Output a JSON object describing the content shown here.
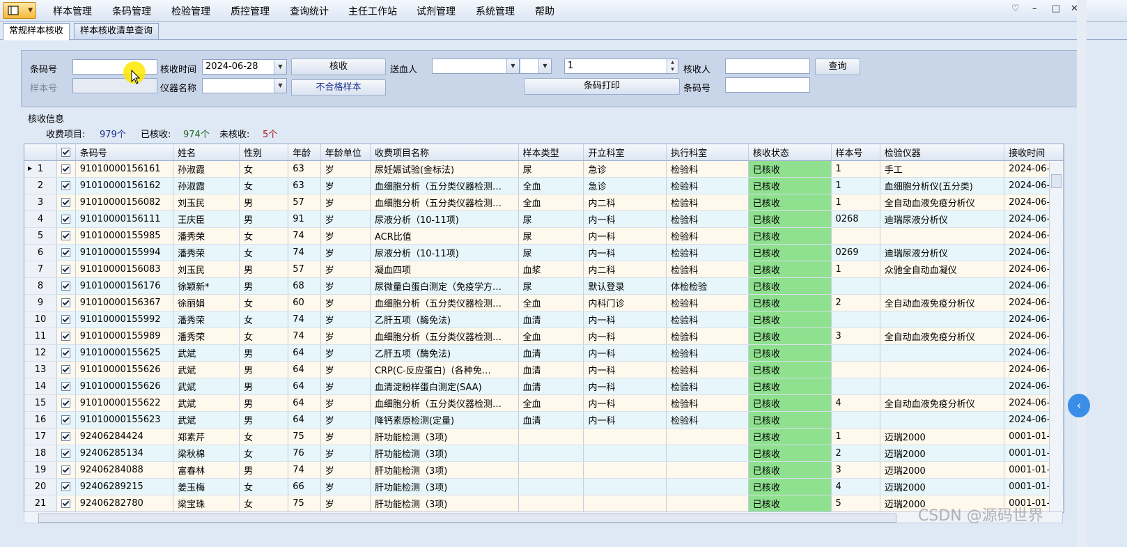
{
  "menu": {
    "items": [
      "样本管理",
      "条码管理",
      "检验管理",
      "质控管理",
      "查询统计",
      "主任工作站",
      "试剂管理",
      "系统管理",
      "帮助"
    ],
    "window_controls": [
      "♡",
      "–",
      "□",
      "✕"
    ]
  },
  "tabs": [
    "常规样本核收",
    "样本核收清单查询"
  ],
  "query": {
    "barcode_label": "条码号",
    "sample_no_label": "样本号",
    "receive_time_label": "核收时间",
    "receive_time_value": "2024-06-28",
    "instrument_label": "仪器名称",
    "instrument_value": "",
    "receive_button": "核收",
    "unqualified_button": "不合格样本",
    "sender_label": "送血人",
    "sender_value": "",
    "sender_sub_value": "",
    "spin_value": "1",
    "print_button": "条码打印",
    "receiver_label": "核收人",
    "receiver_value": "",
    "query_button": "查询",
    "barcode2_label": "条码号",
    "barcode2_value": ""
  },
  "info": {
    "title": "核收信息",
    "fee_items_label": "收费项目:",
    "fee_items_value": "979个",
    "received_label": "已核收:",
    "received_value": "974个",
    "unreceived_label": "未核收:",
    "unreceived_value": "5个"
  },
  "colors": {
    "fee_items": "#1a2d8f",
    "received": "#1f6b1f",
    "unreceived": "#b01515",
    "status_cell": "#8fe08f"
  },
  "grid": {
    "columns": [
      "",
      "",
      "条码号",
      "姓名",
      "性别",
      "年龄",
      "年龄单位",
      "收费项目名称",
      "样本类型",
      "开立科室",
      "执行科室",
      "核收状态",
      "样本号",
      "检验仪器",
      "接收时间"
    ],
    "rows": [
      [
        "1",
        "91010000156161",
        "孙淑霞",
        "女",
        "63",
        "岁",
        "尿妊娠试验(金标法)",
        "尿",
        "急诊",
        "检验科",
        "已核收",
        "1",
        "手工",
        "2024-06-"
      ],
      [
        "2",
        "91010000156162",
        "孙淑霞",
        "女",
        "63",
        "岁",
        "血细胞分析（五分类仪器检测…",
        "全血",
        "急诊",
        "检验科",
        "已核收",
        "1",
        "血细胞分析仪(五分类)",
        "2024-06-"
      ],
      [
        "3",
        "91010000156082",
        "刘玉民",
        "男",
        "57",
        "岁",
        "血细胞分析（五分类仪器检测…",
        "全血",
        "内二科",
        "检验科",
        "已核收",
        "1",
        "全自动血液免疫分析仪",
        "2024-06-"
      ],
      [
        "4",
        "91010000156111",
        "王庆臣",
        "男",
        "91",
        "岁",
        "尿液分析（10-11项)",
        "尿",
        "内一科",
        "检验科",
        "已核收",
        "0268",
        "迪瑞尿液分析仪",
        "2024-06-"
      ],
      [
        "5",
        "91010000155985",
        "潘秀荣",
        "女",
        "74",
        "岁",
        "ACR比值",
        "尿",
        "内一科",
        "检验科",
        "已核收",
        "",
        "",
        "2024-06-"
      ],
      [
        "6",
        "91010000155994",
        "潘秀荣",
        "女",
        "74",
        "岁",
        "尿液分析（10-11项)",
        "尿",
        "内一科",
        "检验科",
        "已核收",
        "0269",
        "迪瑞尿液分析仪",
        "2024-06-"
      ],
      [
        "7",
        "91010000156083",
        "刘玉民",
        "男",
        "57",
        "岁",
        "凝血四项",
        "血浆",
        "内二科",
        "检验科",
        "已核收",
        "1",
        "众驰全自动血凝仪",
        "2024-06-"
      ],
      [
        "8",
        "91010000156176",
        "徐颖新*",
        "男",
        "68",
        "岁",
        "尿微量白蛋白测定（免疫学方…",
        "尿",
        "默认登录",
        "体检检验",
        "已核收",
        "",
        "",
        "2024-06-"
      ],
      [
        "9",
        "91010000156367",
        "徐丽娟",
        "女",
        "60",
        "岁",
        "血细胞分析（五分类仪器检测…",
        "全血",
        "内科门诊",
        "检验科",
        "已核收",
        "2",
        "全自动血液免疫分析仪",
        "2024-06-"
      ],
      [
        "10",
        "91010000155992",
        "潘秀荣",
        "女",
        "74",
        "岁",
        "乙肝五项（酶免法)",
        "血清",
        "内一科",
        "检验科",
        "已核收",
        "",
        "",
        "2024-06-"
      ],
      [
        "11",
        "91010000155989",
        "潘秀荣",
        "女",
        "74",
        "岁",
        "血细胞分析（五分类仪器检测…",
        "全血",
        "内一科",
        "检验科",
        "已核收",
        "3",
        "全自动血液免疫分析仪",
        "2024-06-"
      ],
      [
        "12",
        "91010000155625",
        "武斌",
        "男",
        "64",
        "岁",
        "乙肝五项（酶免法)",
        "血清",
        "内一科",
        "检验科",
        "已核收",
        "",
        "",
        "2024-06-"
      ],
      [
        "13",
        "91010000155626",
        "武斌",
        "男",
        "64",
        "岁",
        "CRP(C-反应蛋白)（各种免…",
        "血清",
        "内一科",
        "检验科",
        "已核收",
        "",
        "",
        "2024-06-"
      ],
      [
        "14",
        "91010000155626",
        "武斌",
        "男",
        "64",
        "岁",
        "血清淀粉样蛋白测定(SAA)",
        "血清",
        "内一科",
        "检验科",
        "已核收",
        "",
        "",
        "2024-06-"
      ],
      [
        "15",
        "91010000155622",
        "武斌",
        "男",
        "64",
        "岁",
        "血细胞分析（五分类仪器检测…",
        "全血",
        "内一科",
        "检验科",
        "已核收",
        "4",
        "全自动血液免疫分析仪",
        "2024-06-"
      ],
      [
        "16",
        "91010000155623",
        "武斌",
        "男",
        "64",
        "岁",
        "降钙素原检测(定量)",
        "血清",
        "内一科",
        "检验科",
        "已核收",
        "",
        "",
        "2024-06-"
      ],
      [
        "17",
        "92406284424",
        "郑素芹",
        "女",
        "75",
        "岁",
        "肝功能检测（3项)",
        "",
        "",
        "",
        "已核收",
        "1",
        "迈瑞2000",
        "0001-01-"
      ],
      [
        "18",
        "92406285134",
        "梁秋棉",
        "女",
        "76",
        "岁",
        "肝功能检测（3项)",
        "",
        "",
        "",
        "已核收",
        "2",
        "迈瑞2000",
        "0001-01-"
      ],
      [
        "19",
        "92406284088",
        "富春林",
        "男",
        "74",
        "岁",
        "肝功能检测（3项)",
        "",
        "",
        "",
        "已核收",
        "3",
        "迈瑞2000",
        "0001-01-"
      ],
      [
        "20",
        "92406289215",
        "姜玉梅",
        "女",
        "66",
        "岁",
        "肝功能检测（3项)",
        "",
        "",
        "",
        "已核收",
        "4",
        "迈瑞2000",
        "0001-01-"
      ],
      [
        "21",
        "92406282780",
        "梁宝珠",
        "女",
        "75",
        "岁",
        "肝功能检测（3项)",
        "",
        "",
        "",
        "已核收",
        "5",
        "迈瑞2000",
        "0001-01-"
      ]
    ]
  },
  "watermark": "CSDN @源码世界"
}
